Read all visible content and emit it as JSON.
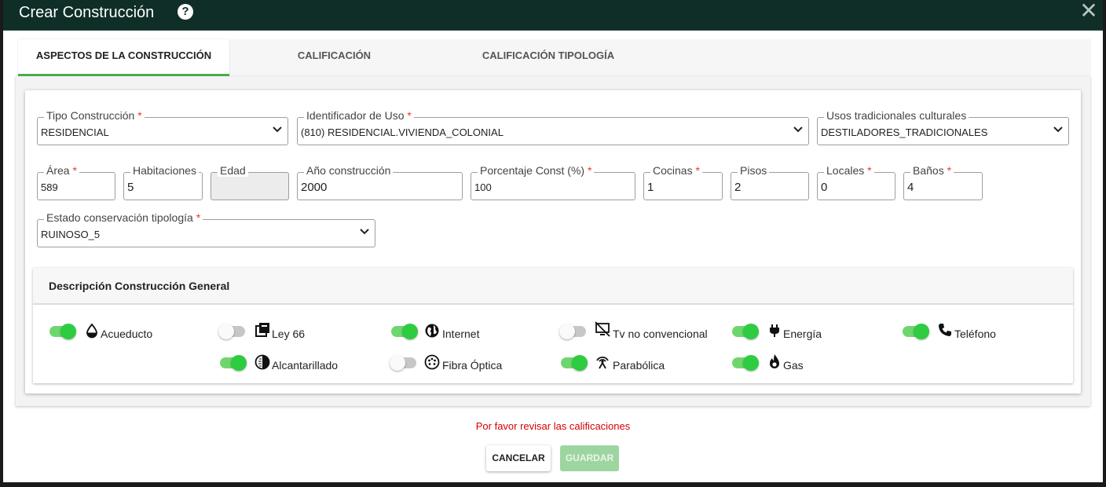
{
  "dialog": {
    "title": "Crear Construcción",
    "help_icon": "?",
    "close_icon": "✕"
  },
  "tabs": [
    {
      "label": "ASPECTOS DE LA CONSTRUCCIÓN",
      "active": true
    },
    {
      "label": "CALIFICACIÓN",
      "active": false
    },
    {
      "label": "CALIFICACIÓN TIPOLOGÍA",
      "active": false
    }
  ],
  "form": {
    "tipo_construccion": {
      "label": "Tipo Construcción",
      "value": "RESIDENCIAL",
      "required": "*"
    },
    "identificador_uso": {
      "label": "Identificador de Uso",
      "value": "(810) RESIDENCIAL.VIVIENDA_COLONIAL",
      "required": "*"
    },
    "usos_tradicionales": {
      "label": "Usos tradicionales culturales",
      "value": "DESTILADORES_TRADICIONALES"
    },
    "area": {
      "label": "Área",
      "value": "589",
      "required": "*"
    },
    "habitaciones": {
      "label": "Habitaciones",
      "value": "5"
    },
    "edad": {
      "label": "Edad",
      "value": ""
    },
    "anio_construccion": {
      "label": "Año construcción",
      "value": "2000"
    },
    "porcentaje_const": {
      "label": "Porcentaje Const (%)",
      "value": "100",
      "required": "*"
    },
    "cocinas": {
      "label": "Cocinas",
      "value": "1",
      "required": "*"
    },
    "pisos": {
      "label": "Pisos",
      "value": "2"
    },
    "locales": {
      "label": "Locales",
      "value": "0",
      "required": "*"
    },
    "banos": {
      "label": "Baños",
      "value": "4",
      "required": "*"
    },
    "estado_conservacion": {
      "label": "Estado conservación tipología",
      "value": "RUINOSO_5",
      "required": "*"
    }
  },
  "descripcion": {
    "title": "Descripción Construcción General",
    "services": [
      {
        "label": "Acueducto",
        "on": true,
        "icon": "water-drop-icon"
      },
      {
        "label": "Ley 66",
        "on": false,
        "icon": "library-books-icon"
      },
      {
        "label": "Internet",
        "on": true,
        "icon": "globe-icon"
      },
      {
        "label": "Tv no convencional",
        "on": false,
        "icon": "tv-off-icon"
      },
      {
        "label": "Energía",
        "on": true,
        "icon": "power-plug-icon"
      },
      {
        "label": "Teléfono",
        "on": true,
        "icon": "phone-icon"
      },
      {
        "label": "Alcantarillado",
        "on": true,
        "icon": "contrast-icon"
      },
      {
        "label": "Fibra Óptica",
        "on": false,
        "icon": "fiber-connector-icon"
      },
      {
        "label": "Parabólica",
        "on": true,
        "icon": "antenna-icon"
      },
      {
        "label": "Gas",
        "on": true,
        "icon": "flame-icon"
      }
    ]
  },
  "footer": {
    "warning": "Por favor revisar las calificaciones",
    "cancel_label": "CANCELAR",
    "save_label": "GUARDAR"
  },
  "colors": {
    "header_bg": "#0f2e27",
    "accent_green": "#4caf50",
    "toggle_on": "#2ecc40",
    "warning_red": "#d50000",
    "save_disabled": "#9dd5a0"
  }
}
